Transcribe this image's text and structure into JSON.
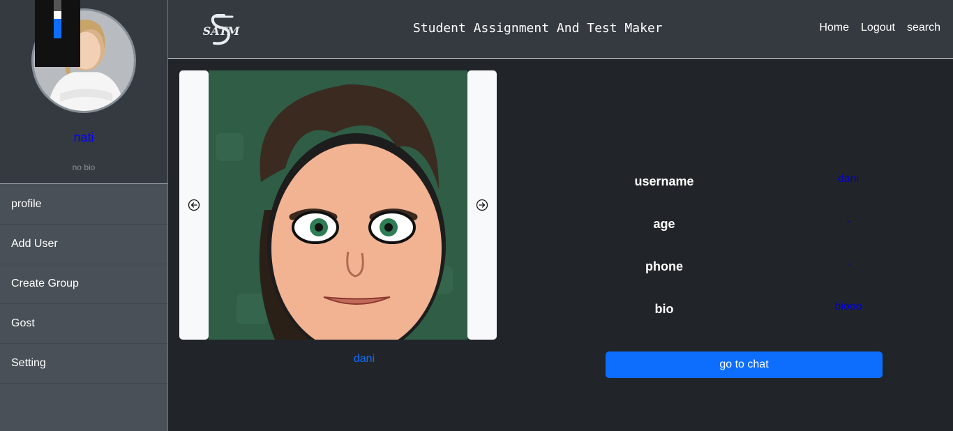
{
  "header": {
    "logo_text": "SATM",
    "title": "Student Assignment And Test Maker",
    "nav": [
      "Home",
      "Logout",
      "search"
    ]
  },
  "sidebar": {
    "user_name": "nati",
    "user_bio": "no bio",
    "progress_widget": {
      "fill_fraction": 0.5,
      "color": "#0d6efd"
    },
    "menu": [
      {
        "label": "profile"
      },
      {
        "label": "Add User"
      },
      {
        "label": "Create Group"
      },
      {
        "label": "Gost"
      },
      {
        "label": "Setting"
      }
    ]
  },
  "carousel": {
    "caption": "dani",
    "prev_icon": "arrow-left-circle-icon",
    "next_icon": "arrow-right-circle-icon"
  },
  "profile_details": [
    {
      "label": "username",
      "value": "dani"
    },
    {
      "label": "age",
      "value": "-"
    },
    {
      "label": "phone",
      "value": "-"
    },
    {
      "label": "bio",
      "value": "biooo"
    }
  ],
  "actions": {
    "chat_label": "go to chat"
  },
  "colors": {
    "accent": "#0d6efd",
    "value_text": "#0000cc",
    "sidebar": "#495057",
    "header": "#343a40",
    "background": "#212529"
  }
}
